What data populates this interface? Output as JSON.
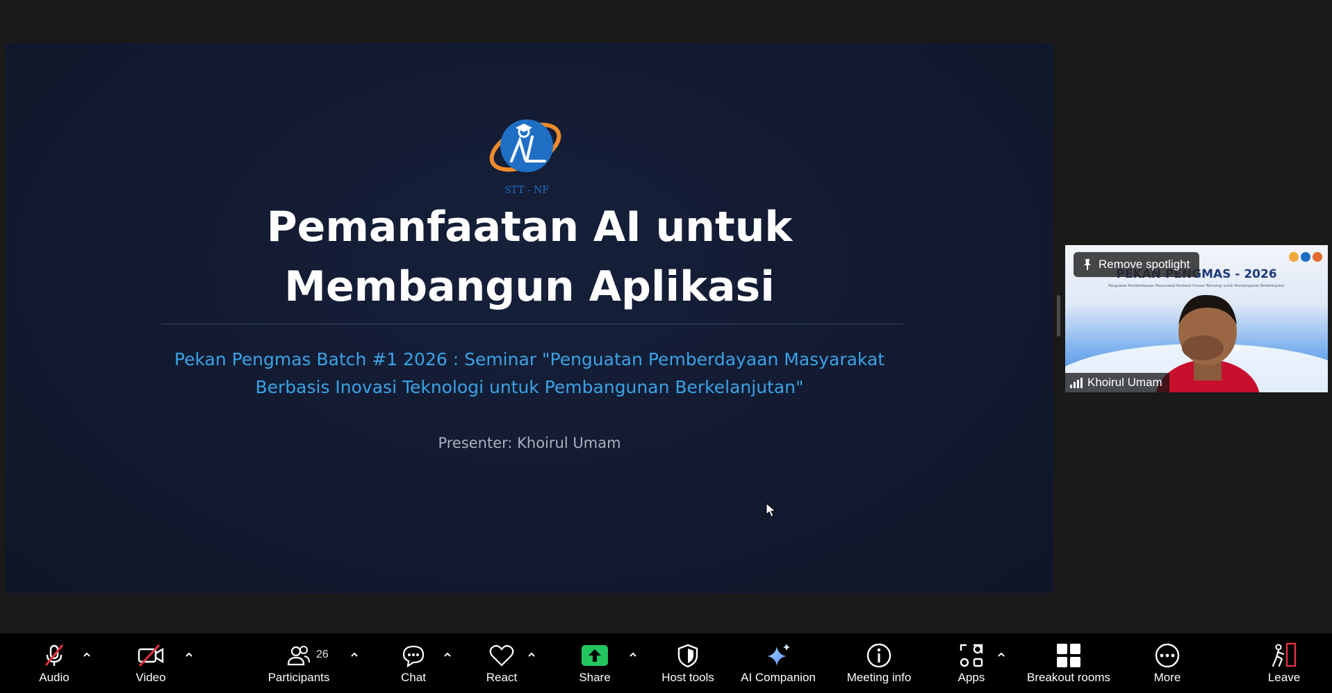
{
  "slide": {
    "logo_caption": "STT - NF",
    "title_line1": "Pemanfaatan AI untuk",
    "title_line2": "Membangun Aplikasi",
    "subtitle_line1": "Pekan Pengmas Batch #1 2026 : Seminar \"Penguatan Pemberdayaan Masyarakat",
    "subtitle_line2": "Berbasis Inovasi Teknologi untuk Pembangunan Berkelanjutan\"",
    "presenter": "Presenter: Khoirul Umam"
  },
  "participant_tile": {
    "spotlight_label": "Remove spotlight",
    "name": "Khoirul Umam",
    "banner_title": "PEKAN PENGMAS - 2026",
    "banner_subtitle": "Penguatan Pemberdayaan Masyarakat Berbasis Inovasi Teknologi untuk Pembangunan Berkelanjutan"
  },
  "toolbar": {
    "audio": "Audio",
    "video": "Video",
    "participants": "Participants",
    "participants_count": "26",
    "chat": "Chat",
    "react": "React",
    "share": "Share",
    "host_tools": "Host tools",
    "ai_companion": "AI Companion",
    "meeting_info": "Meeting info",
    "apps": "Apps",
    "breakout_rooms": "Breakout rooms",
    "more": "More",
    "leave": "Leave"
  },
  "colors": {
    "slide_bg": "#121a30",
    "subtitle_blue": "#3aa3e6",
    "share_green": "#22c55e",
    "muted_red": "#e5313d",
    "toolbar_bg": "#000000"
  },
  "icons": {
    "audio": "microphone-muted-icon",
    "video": "camera-off-icon",
    "participants": "people-icon",
    "chat": "chat-bubble-icon",
    "react": "heart-icon",
    "share": "share-arrow-icon",
    "host_tools": "shield-icon",
    "ai_companion": "sparkle-icon",
    "meeting_info": "info-icon",
    "apps": "apps-grid-icon",
    "breakout_rooms": "breakout-grid-icon",
    "more": "ellipsis-icon",
    "leave": "leave-door-icon"
  }
}
